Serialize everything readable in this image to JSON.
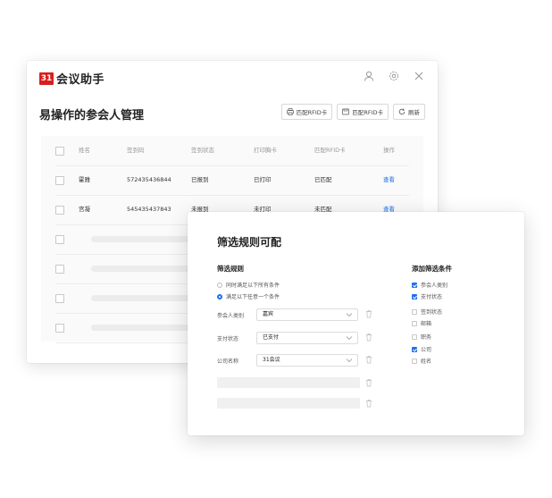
{
  "app": {
    "logo_mark": "31",
    "logo_text": "会议助手"
  },
  "window": {
    "page_title": "易操作的参会人管理",
    "toolbar": {
      "match_rfid_print": "匹配RFID卡",
      "match_rfid_card": "匹配RFID卡",
      "refresh": "刷新"
    },
    "table": {
      "headers": [
        "姓名",
        "签到码",
        "签到状态",
        "打印胸卡",
        "匹配RFID卡",
        "操作"
      ],
      "rows": [
        [
          "霍雅",
          "572435436844",
          "已报到",
          "已打印",
          "已匹配",
          "查看"
        ],
        [
          "宫凝",
          "545435437843",
          "未报到",
          "未打印",
          "未匹配",
          "查看"
        ]
      ]
    }
  },
  "dialog": {
    "title": "筛选规则可配",
    "rules_title": "筛选规则",
    "radio_options": [
      "同时满足以下所有条件",
      "满足以下任意一个条件"
    ],
    "radio_selected": 1,
    "fields": [
      {
        "label": "参会人类别",
        "value": "嘉宾"
      },
      {
        "label": "支付状态",
        "value": "已支付"
      },
      {
        "label": "公司名称",
        "value": "31会议"
      }
    ],
    "conditions_title": "添加筛选条件",
    "conditions": [
      {
        "label": "参会人类别",
        "checked": true
      },
      {
        "label": "支付状态",
        "checked": true
      },
      {
        "label": "签到状态",
        "checked": false
      },
      {
        "label": "邮箱",
        "checked": false
      },
      {
        "label": "职务",
        "checked": false
      },
      {
        "label": "公司",
        "checked": true
      },
      {
        "label": "姓名",
        "checked": false
      }
    ]
  },
  "colors": {
    "brand_red": "#d71e1e",
    "accent_blue": "#1f6feb"
  }
}
